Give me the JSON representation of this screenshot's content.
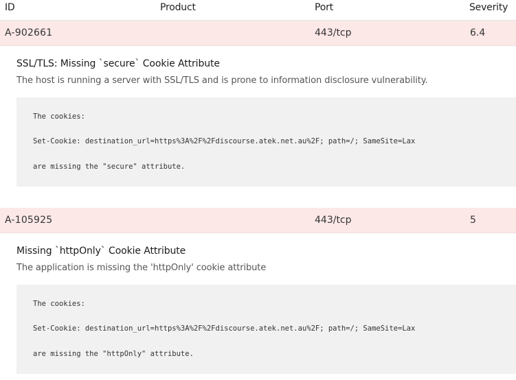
{
  "table": {
    "headers": {
      "id": "ID",
      "product": "Product",
      "port": "Port",
      "severity": "Severity"
    },
    "rows": [
      {
        "id": "A-902661",
        "product": "",
        "port": "443/tcp",
        "severity": "6.4",
        "title": "SSL/TLS: Missing `secure` Cookie Attribute",
        "description": "The host is running a server with SSL/TLS and is prone to information disclosure vulnerability.",
        "code": [
          "The cookies:",
          "Set-Cookie: destination_url=https%3A%2F%2Fdiscourse.atek.net.au%2F; path=/; SameSite=Lax",
          "are missing the \"secure\" attribute."
        ]
      },
      {
        "id": "A-105925",
        "product": "",
        "port": "443/tcp",
        "severity": "5",
        "title": "Missing `httpOnly` Cookie Attribute",
        "description": "The application is missing the 'httpOnly' cookie attribute",
        "code": [
          "The cookies:",
          "Set-Cookie: destination_url=https%3A%2F%2Fdiscourse.atek.net.au%2F; path=/; SameSite=Lax",
          "are missing the \"httpOnly\" attribute."
        ]
      }
    ]
  },
  "colors": {
    "row_highlight": "#fde8e8",
    "code_background": "#f1f1f1"
  }
}
